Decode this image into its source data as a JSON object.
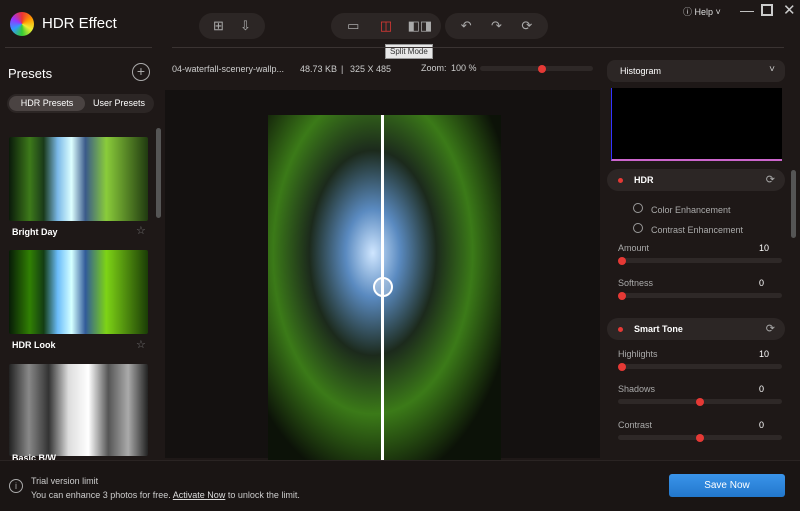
{
  "app": {
    "title": "HDR Effect",
    "help": "Help"
  },
  "toolbar": {
    "tooltip": "Split Mode"
  },
  "file": {
    "name": "04-waterfall-scenery-wallp...",
    "size": "48.73 KB",
    "sep": "|",
    "dims": "325 X 485",
    "zoom_label": "Zoom:",
    "zoom_value": "100 %",
    "zoom_fraction": 0.55
  },
  "presets": {
    "title": "Presets",
    "tabs": [
      "HDR Presets",
      "User Presets"
    ],
    "items": [
      {
        "label": "Bright Day"
      },
      {
        "label": "HDR Look"
      },
      {
        "label": "Basic B/W"
      }
    ]
  },
  "right": {
    "histogram": "Histogram",
    "hdr": {
      "title": "HDR",
      "options": [
        "Color Enhancement",
        "Contrast Enhancement"
      ],
      "sliders": [
        {
          "label": "Amount",
          "value": "10",
          "fraction": 0
        },
        {
          "label": "Softness",
          "value": "0",
          "fraction": 0
        }
      ]
    },
    "tone": {
      "title": "Smart Tone",
      "sliders": [
        {
          "label": "Highlights",
          "value": "10",
          "fraction": 0
        },
        {
          "label": "Shadows",
          "value": "0",
          "fraction": 0.5
        },
        {
          "label": "Contrast",
          "value": "0",
          "fraction": 0.5
        }
      ]
    }
  },
  "footer": {
    "title": "Trial version limit",
    "msg_pre": "You can enhance 3 photos for free.",
    "link": "Activate Now",
    "msg_post": "to unlock the limit.",
    "save": "Save Now"
  },
  "colors": {
    "accent": "#e53935",
    "save": "#2e86de"
  }
}
